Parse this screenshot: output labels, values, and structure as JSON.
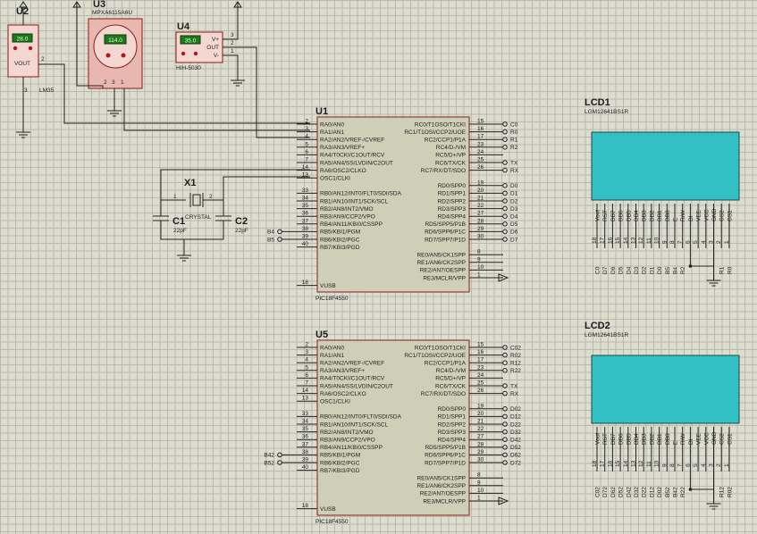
{
  "components": {
    "u2": {
      "ref": "U2",
      "type": "LM35",
      "display": "28.0",
      "pin_label": "VOUT",
      "pins": [
        "1",
        "2",
        "3"
      ]
    },
    "u3": {
      "ref": "U3",
      "type": "MPXA6115A6U",
      "display": "114.0",
      "pins": [
        "2",
        "3",
        "1"
      ]
    },
    "u4": {
      "ref": "U4",
      "type": "HIH-5030",
      "display": "35.0",
      "pin_labels": [
        "V+",
        "OUT",
        "V-"
      ],
      "pins": [
        "3",
        "2",
        "1"
      ]
    },
    "x1": {
      "ref": "X1",
      "type": "CRYSTAL"
    },
    "c1": {
      "ref": "C1",
      "value": "22pF"
    },
    "c2": {
      "ref": "C2",
      "value": "22pF"
    }
  },
  "mcus": [
    {
      "ref": "U1",
      "part": "PIC18F4550",
      "left_pins": [
        {
          "num": "2",
          "name": "RA0/AN0"
        },
        {
          "num": "3",
          "name": "RA1/AN1"
        },
        {
          "num": "4",
          "name": "RA2/AN2/VREF-/CVREF"
        },
        {
          "num": "5",
          "name": "RA3/AN3/VREF+"
        },
        {
          "num": "6",
          "name": "RA4/T0CKI/C1OUT/RCV"
        },
        {
          "num": "7",
          "name": "RA5/AN4/SS/LVDIN/C2OUT"
        },
        {
          "num": "14",
          "name": "RA6/OSC2/CLKO"
        },
        {
          "num": "13",
          "name": "OSC1/CLKI"
        },
        {
          "num": "33",
          "name": "RB0/AN12/INT0/FLT0/SDI/SDA"
        },
        {
          "num": "34",
          "name": "RB1/AN10/INT1/SCK/SCL"
        },
        {
          "num": "35",
          "name": "RB2/AN8/INT2/VMO"
        },
        {
          "num": "36",
          "name": "RB3/AN9/CCP2/VPO"
        },
        {
          "num": "37",
          "name": "RB4/AN11/KBI0/CSSPP"
        },
        {
          "num": "38",
          "name": "RB5/KBI1/PGM"
        },
        {
          "num": "39",
          "name": "RB6/KBI2/PGC"
        },
        {
          "num": "40",
          "name": "RB7/KBI3/PGD"
        },
        {
          "num": "18",
          "name": "VUSB"
        }
      ],
      "right_pins": [
        {
          "num": "15",
          "name": "RC0/T1OSO/T1CKI",
          "net": "C0"
        },
        {
          "num": "16",
          "name": "RC1/T1OSI/CCP2/UOE",
          "net": "R0"
        },
        {
          "num": "17",
          "name": "RC2/CCP1/P1A",
          "net": "R1"
        },
        {
          "num": "23",
          "name": "RC4/D-/VM",
          "net": "R2"
        },
        {
          "num": "24",
          "name": "RC5/D+/VP",
          "net": ""
        },
        {
          "num": "25",
          "name": "RC6/TX/CK",
          "net": "TX"
        },
        {
          "num": "26",
          "name": "RC7/RX/DT/SDO",
          "net": "RX"
        },
        {
          "num": "19",
          "name": "RD0/SPP0",
          "net": "D0"
        },
        {
          "num": "20",
          "name": "RD1/SPP1",
          "net": "D1"
        },
        {
          "num": "21",
          "name": "RD2/SPP2",
          "net": "D2"
        },
        {
          "num": "22",
          "name": "RD3/SPP3",
          "net": "D3"
        },
        {
          "num": "27",
          "name": "RD4/SPP4",
          "net": "D4"
        },
        {
          "num": "28",
          "name": "RD5/SPP5/P1B",
          "net": "D5"
        },
        {
          "num": "29",
          "name": "RD6/SPP6/P1C",
          "net": "D6"
        },
        {
          "num": "30",
          "name": "RD7/SPP7/P1D",
          "net": "D7"
        },
        {
          "num": "8",
          "name": "RE0/AN5/CK1SPP",
          "net": ""
        },
        {
          "num": "9",
          "name": "RE1/AN6/CK2SPP",
          "net": ""
        },
        {
          "num": "10",
          "name": "RE2/AN7/OESPP",
          "net": ""
        },
        {
          "num": "1",
          "name": "RE3/MCLR/VPP",
          "net": ""
        }
      ],
      "left_nets": {
        "rb4": "B4",
        "rb5": "B5"
      }
    },
    {
      "ref": "U5",
      "part": "PIC18F4550",
      "left_pins": [
        {
          "num": "2",
          "name": "RA0/AN0"
        },
        {
          "num": "3",
          "name": "RA1/AN1"
        },
        {
          "num": "4",
          "name": "RA2/AN2/VREF-/CVREF"
        },
        {
          "num": "5",
          "name": "RA3/AN3/VREF+"
        },
        {
          "num": "6",
          "name": "RA4/T0CKI/C1OUT/RCV"
        },
        {
          "num": "7",
          "name": "RA5/AN4/SS/LVDIN/C2OUT"
        },
        {
          "num": "14",
          "name": "RA6/OSC2/CLKO"
        },
        {
          "num": "13",
          "name": "OSC1/CLKI"
        },
        {
          "num": "33",
          "name": "RB0/AN12/INT0/FLT0/SDI/SDA"
        },
        {
          "num": "34",
          "name": "RB1/AN10/INT1/SCK/SCL"
        },
        {
          "num": "35",
          "name": "RB2/AN8/INT2/VMO"
        },
        {
          "num": "36",
          "name": "RB3/AN9/CCP2/VPO"
        },
        {
          "num": "37",
          "name": "RB4/AN11/KBI0/CSSPP"
        },
        {
          "num": "38",
          "name": "RB5/KBI1/PGM"
        },
        {
          "num": "39",
          "name": "RB6/KBI2/PGC"
        },
        {
          "num": "40",
          "name": "RB7/KBI3/PGD"
        },
        {
          "num": "18",
          "name": "VUSB"
        }
      ],
      "right_pins": [
        {
          "num": "15",
          "name": "RC0/T1OSO/T1CKI",
          "net": "C02"
        },
        {
          "num": "16",
          "name": "RC1/T1OSI/CCP2/UOE",
          "net": "R02"
        },
        {
          "num": "17",
          "name": "RC2/CCP1/P1A",
          "net": "R12"
        },
        {
          "num": "23",
          "name": "RC4/D-/VM",
          "net": "R22"
        },
        {
          "num": "24",
          "name": "RC5/D+/VP",
          "net": ""
        },
        {
          "num": "25",
          "name": "RC6/TX/CK",
          "net": "TX"
        },
        {
          "num": "26",
          "name": "RC7/RX/DT/SDO",
          "net": "RX"
        },
        {
          "num": "19",
          "name": "RD0/SPP0",
          "net": "D02"
        },
        {
          "num": "20",
          "name": "RD1/SPP1",
          "net": "D12"
        },
        {
          "num": "21",
          "name": "RD2/SPP2",
          "net": "D22"
        },
        {
          "num": "22",
          "name": "RD3/SPP3",
          "net": "D32"
        },
        {
          "num": "27",
          "name": "RD4/SPP4",
          "net": "D42"
        },
        {
          "num": "28",
          "name": "RD5/SPP5/P1B",
          "net": "D52"
        },
        {
          "num": "29",
          "name": "RD6/SPP6/P1C",
          "net": "D62"
        },
        {
          "num": "30",
          "name": "RD7/SPP7/P1D",
          "net": "D72"
        },
        {
          "num": "8",
          "name": "RE0/AN5/CK1SPP",
          "net": ""
        },
        {
          "num": "9",
          "name": "RE1/AN6/CK2SPP",
          "net": ""
        },
        {
          "num": "10",
          "name": "RE2/AN7/OESPP",
          "net": ""
        },
        {
          "num": "1",
          "name": "RE3/MCLR/VPP",
          "net": ""
        }
      ],
      "left_nets": {
        "rb4": "B42",
        "rb5": "B52"
      }
    }
  ],
  "lcds": [
    {
      "ref": "LCD1",
      "part": "LGM12641BS1R",
      "pin_names": [
        "Vout",
        "RST",
        "DB7",
        "DB6",
        "DB5",
        "DB4",
        "DB3",
        "DB2",
        "DB1",
        "DB0",
        "E",
        "R/W",
        "DI",
        "VEE",
        "VCC",
        "GND",
        "CS2",
        "CS1"
      ],
      "pin_nums": [
        "18",
        "17",
        "16",
        "15",
        "14",
        "13",
        "12",
        "11",
        "10",
        "9",
        "8",
        "7",
        "6",
        "5",
        "4",
        "3",
        "2",
        "1"
      ],
      "nets": [
        "C0",
        "D7",
        "D6",
        "D5",
        "D4",
        "D3",
        "D2",
        "D1",
        "D0",
        "B5",
        "B4",
        "R2",
        "",
        "",
        "",
        "",
        "R1",
        "R0"
      ]
    },
    {
      "ref": "LCD2",
      "part": "LGM12641BS1R",
      "pin_names": [
        "Vout",
        "RST",
        "DB7",
        "DB6",
        "DB5",
        "DB4",
        "DB3",
        "DB2",
        "DB1",
        "DB0",
        "E",
        "R/W",
        "DI",
        "VEE",
        "VCC",
        "GND",
        "CS2",
        "CS1"
      ],
      "pin_nums": [
        "18",
        "17",
        "16",
        "15",
        "14",
        "13",
        "12",
        "11",
        "10",
        "9",
        "8",
        "7",
        "6",
        "5",
        "4",
        "3",
        "2",
        "1"
      ],
      "nets": [
        "C02",
        "D72",
        "D62",
        "D52",
        "D42",
        "D32",
        "D22",
        "D12",
        "D02",
        "B52",
        "B42",
        "R22",
        "",
        "",
        "",
        "",
        "R12",
        "R02"
      ]
    }
  ],
  "colors": {
    "lcd_screen": "#32c0c4",
    "sensor_body": "#f4d7d1",
    "sensor_outline": "#8b1a1a",
    "display_bg": "#1c7a1c",
    "display_text": "#e8ffd0",
    "chip_fill": "#cfcfb8"
  }
}
